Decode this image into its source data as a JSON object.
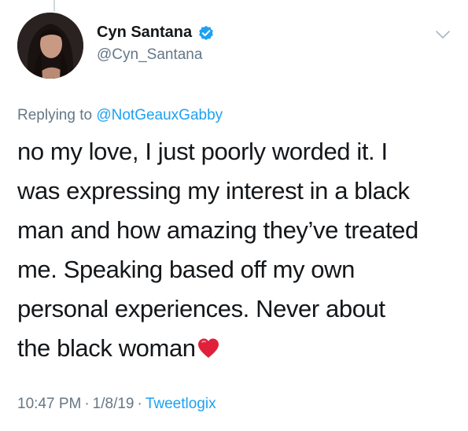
{
  "author": {
    "display_name": "Cyn Santana",
    "handle": "@Cyn_Santana",
    "verified": true
  },
  "reply": {
    "prefix": "Replying to",
    "mention": "@NotGeauxGabby"
  },
  "tweet": {
    "lines": [
      "no my love, I just poorly worded it. I",
      "was expressing my interest in a black",
      "man and how amazing they’ve treated",
      "me. Speaking based off my own",
      "personal experiences. Never about",
      "the black woman"
    ],
    "trailing_emoji": "heart-emoji"
  },
  "meta": {
    "time": "10:47 PM",
    "separator": "·",
    "date": "1/8/19",
    "source": "Tweetlogix"
  },
  "icons": {
    "verified": "verified-badge-icon",
    "menu": "chevron-down-icon"
  },
  "colors": {
    "link_blue": "#1da1f2",
    "secondary_gray": "#657786",
    "text_primary": "#14171a",
    "heart_red": "#e0203a"
  }
}
